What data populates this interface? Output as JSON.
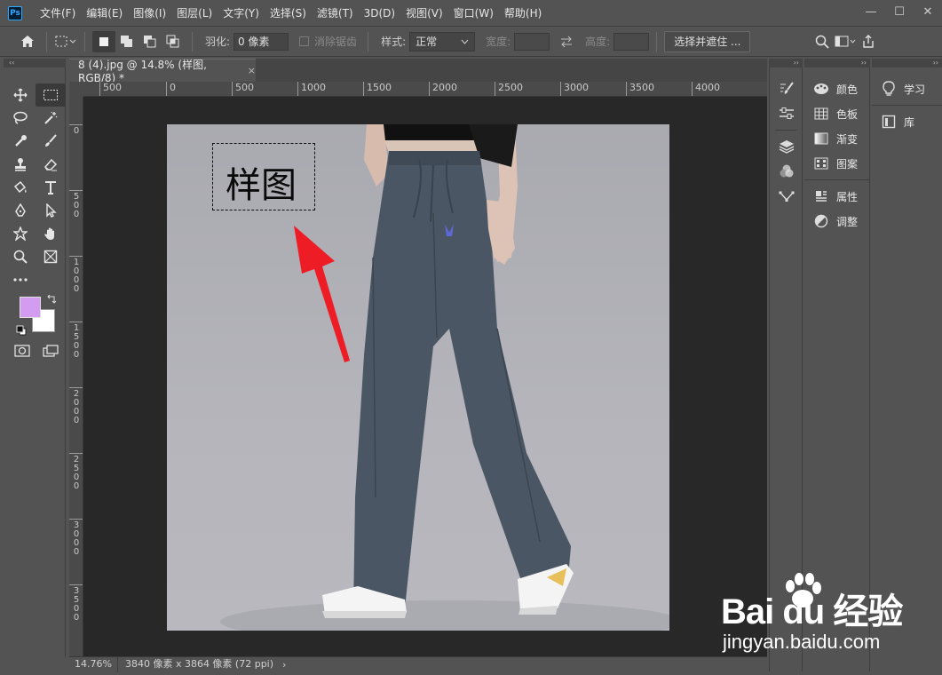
{
  "app": {
    "logo_text": "Ps"
  },
  "menu": [
    "文件(F)",
    "编辑(E)",
    "图像(I)",
    "图层(L)",
    "文字(Y)",
    "选择(S)",
    "滤镜(T)",
    "3D(D)",
    "视图(V)",
    "窗口(W)",
    "帮助(H)"
  ],
  "window_controls": {
    "minimize": "—",
    "maximize": "☐",
    "close": "✕"
  },
  "options": {
    "feather_label": "羽化:",
    "feather_value": "0 像素",
    "antialias_label": "消除锯齿",
    "style_label": "样式:",
    "style_value": "正常",
    "width_label": "宽度:",
    "height_label": "高度:",
    "select_mask_button": "选择并遮住 ..."
  },
  "document": {
    "tab_title": "8 (4).jpg @ 14.8% (样图, RGB/8) *",
    "tab_close": "×",
    "selection_text": "样图"
  },
  "rulers": {
    "horizontal": [
      "500",
      "0",
      "500",
      "1000",
      "1500",
      "2000",
      "2500",
      "3000",
      "3500",
      "4000"
    ],
    "vertical": [
      "0",
      "5\n0\n0",
      "1\n0\n0\n0",
      "1\n5\n0\n0",
      "2\n0\n0\n0",
      "2\n5\n0\n0",
      "3\n0\n0\n0",
      "3\n5\n0\n0"
    ]
  },
  "status": {
    "zoom": "14.76%",
    "info": "3840 像素 x 3864 像素 (72 ppi)",
    "arrow": "›"
  },
  "colors": {
    "foreground": "#d49cf0",
    "background": "#ffffff",
    "annotation_arrow": "#ee1c25",
    "pants": "#4a5663"
  },
  "panels": {
    "group1": [
      {
        "icon": "palette-icon",
        "label": "颜色"
      },
      {
        "icon": "grid-icon",
        "label": "色板"
      },
      {
        "icon": "gradient-icon",
        "label": "渐变"
      },
      {
        "icon": "pattern-icon",
        "label": "图案"
      }
    ],
    "group2": [
      {
        "icon": "properties-icon",
        "label": "属性"
      },
      {
        "icon": "adjust-icon",
        "label": "调整"
      }
    ],
    "group3": [
      {
        "icon": "bulb-icon",
        "label": "学习"
      },
      {
        "icon": "library-icon",
        "label": "库"
      }
    ]
  },
  "watermark": {
    "logo": "Bai du 经验",
    "url": "jingyan.baidu.com"
  }
}
